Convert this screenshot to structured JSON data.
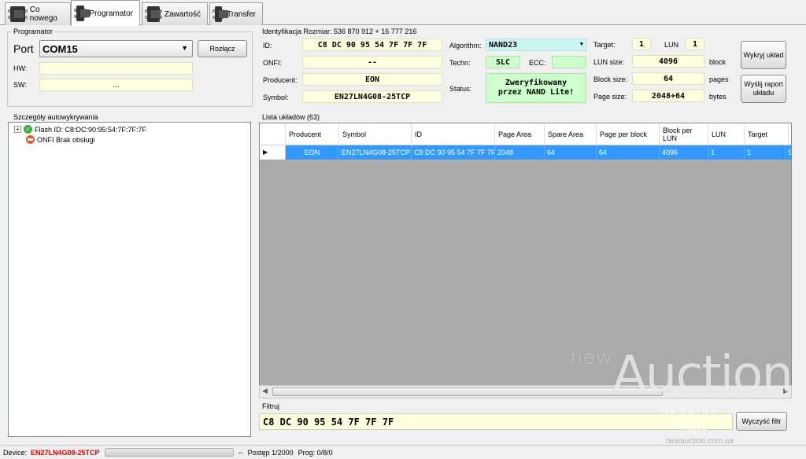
{
  "tabs": [
    {
      "label": "Co nowego"
    },
    {
      "label": "Programator"
    },
    {
      "label": "Zawartość"
    },
    {
      "label": "Transfer"
    }
  ],
  "programator": {
    "title": "Programator",
    "port_label": "Port",
    "port_value": "COM15",
    "disconnect_label": "Rozłącz",
    "hw_label": "HW:",
    "hw_value": "",
    "sw_label": "SW:",
    "sw_value": "..."
  },
  "identification": {
    "title": "Identyfikacja Rozmiar:",
    "size_value": "536 870 912 +  16 777 216",
    "id_label": "ID:",
    "id_value": "C8 DC 90 95 54 7F 7F 7F",
    "onfi_label": "ONFI:",
    "onfi_value": "--",
    "producent_label": "Producent:",
    "producent_value": "EON",
    "symbol_label": "Symbol:",
    "symbol_value": "EN27LN4G08-25TCP",
    "algorithm_label": "Algorithm:",
    "algorithm_value": "NAND23",
    "techn_label": "Techn:",
    "techn_value": "SLC",
    "ecc_label": "ECC:",
    "ecc_value": "",
    "status_label": "Status:",
    "status_value_1": "Zweryfikowany",
    "status_value_2": "przez NAND Lite!",
    "target_label": "Target:",
    "target_value": "1",
    "lun_label": "LUN",
    "lun_value": "1",
    "lun_size_label": "LUN size:",
    "lun_size_value": "4096",
    "lun_size_unit": "block",
    "block_size_label": "Block size:",
    "block_size_value": "64",
    "block_size_unit": "pages",
    "page_size_label": "Page size:",
    "page_size_value": "2048+64",
    "page_size_unit": "bytes",
    "detect_button": "Wykryj układ",
    "report_button": "Wyślij raport układu"
  },
  "autodetect": {
    "title": "Szczegóły autowykrywania",
    "items": [
      {
        "label": "Flash ID: C8:DC:90:95:54:7F:7F:7F"
      },
      {
        "label": "ONFI Brak obsługi"
      }
    ]
  },
  "chip_list": {
    "title": "Lista układów (63)",
    "columns": [
      "Producent",
      "Symbol",
      "ID",
      "Page Area",
      "Spare Area",
      "Page per block",
      "Block per LUN",
      "LUN",
      "Target"
    ],
    "rows": [
      {
        "cells": [
          "EON",
          "EN27LN4G08-25TCP",
          "C8 DC 90 95 54 7F 7F 7F",
          "2048",
          "64",
          "64",
          "4096",
          "1",
          "1",
          "S"
        ]
      }
    ]
  },
  "filter": {
    "title": "Filtruj",
    "value": "C8 DC 90 95 54 7F 7F 7F",
    "clear_button": "Wyczyść filtr"
  },
  "statusbar": {
    "device_label": "Device:",
    "device_value": "EN27LN4G08-25TCP",
    "separator": "--",
    "progress_text": "Postęp 1/2000",
    "prog_text": "Prog: 0/8/0"
  },
  "watermark": {
    "new": "new",
    "brand": "Auction",
    "country": "UKRAINE",
    "name": "Yajeb",
    "url": "newauction.com.ua"
  },
  "colors": {
    "field_bg": "#ffffe0",
    "algorithm_bg": "#ccf5f5",
    "green_bg": "#ccffcc",
    "selection": "#3399ff",
    "device_red": "#e00000"
  }
}
